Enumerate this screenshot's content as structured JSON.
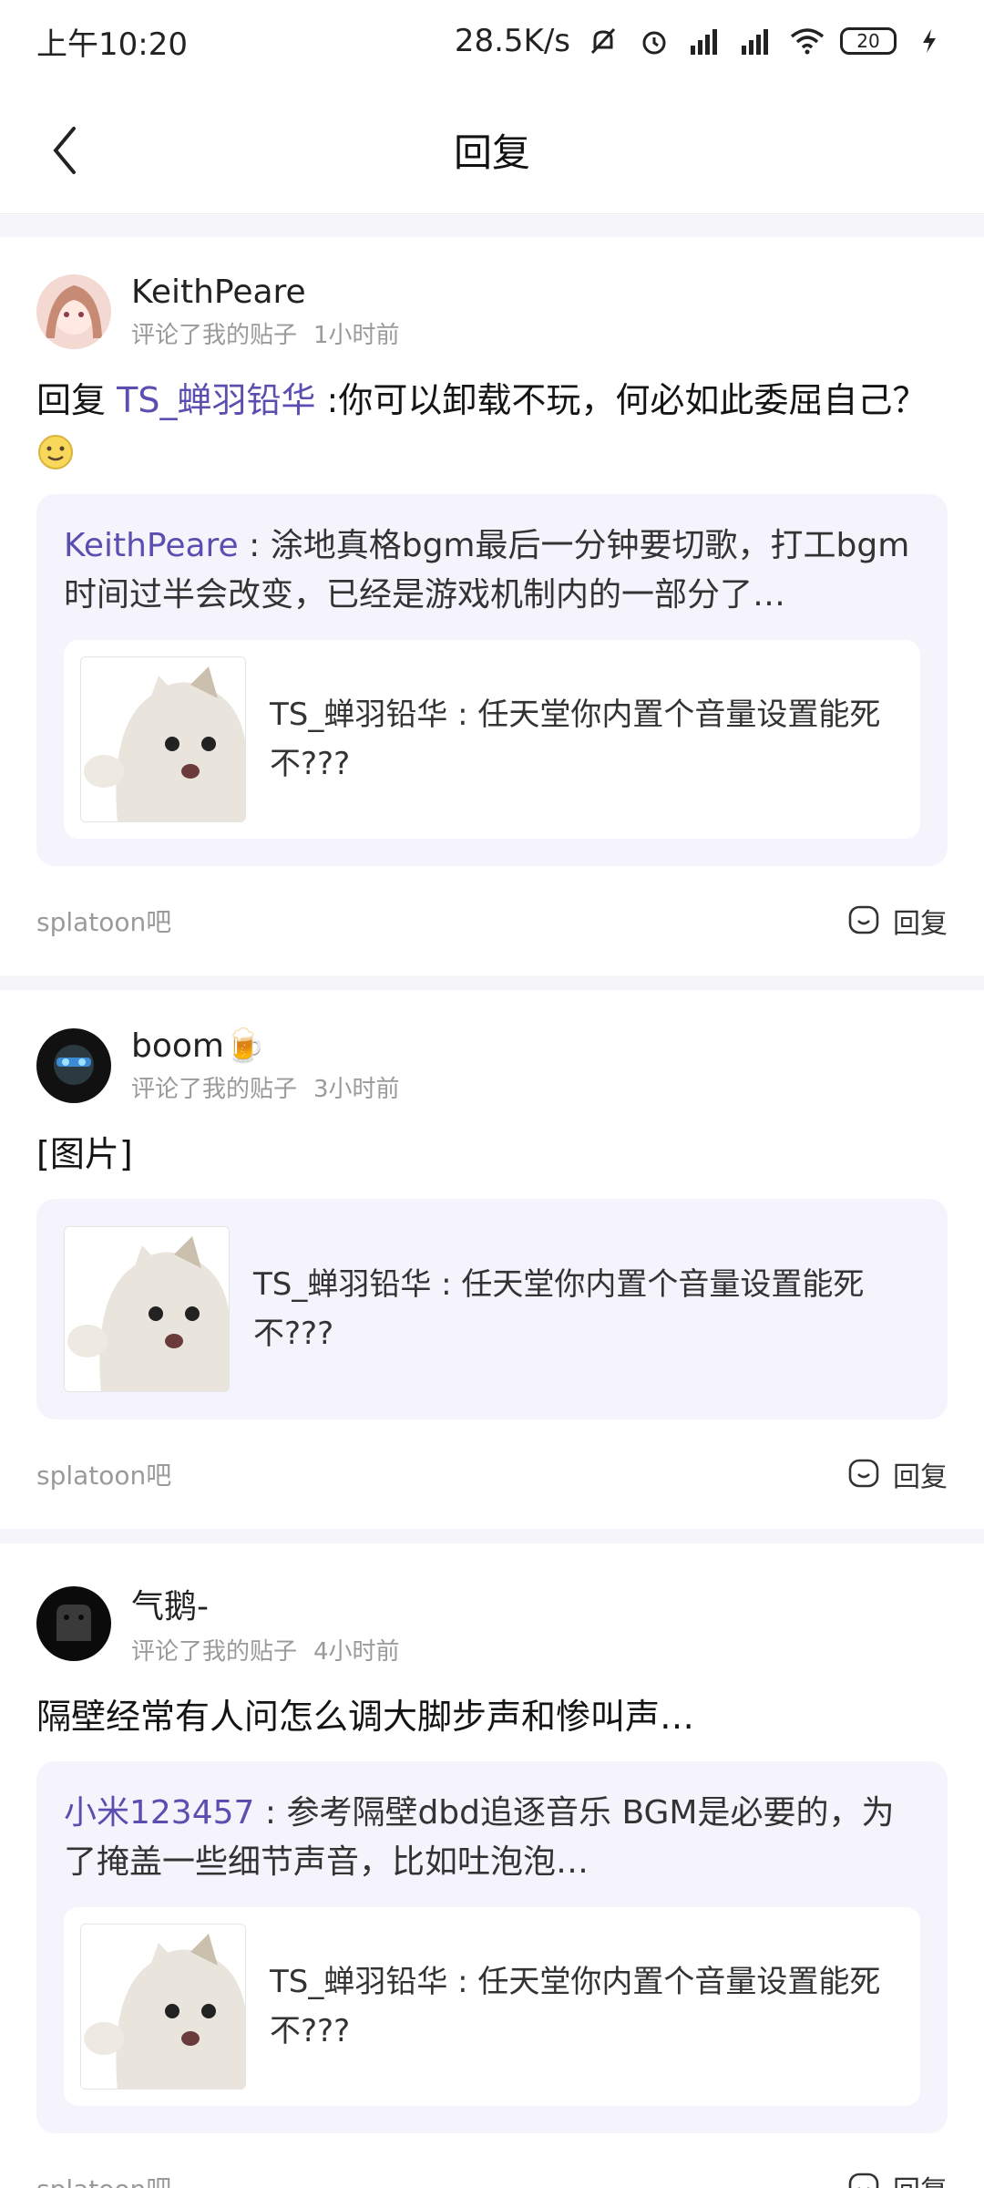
{
  "status": {
    "time": "上午10:20",
    "speed": "28.5K/s",
    "battery": "20"
  },
  "nav": {
    "title": "回复"
  },
  "cards": [
    {
      "username": "KeithPeare",
      "action": "评论了我的贴子",
      "time": "1小时前",
      "reply_prefix": "回复",
      "mention": "TS_蝉羽铅华",
      "content": " :你可以卸载不玩，何必如此委屈自己？",
      "quote_user": "KeithPeare",
      "quote_text": " : 涂地真格bgm最后一分钟要切歌，打工bgm时间过半会改变，已经是游戏机制内的一部分了…",
      "orig_text": "TS_蝉羽铅华 : 任天堂你内置个音量设置能死不???",
      "tieba": "splatoon吧",
      "reply_label": "回复"
    },
    {
      "username": "boom🍺",
      "action": "评论了我的贴子",
      "time": "3小时前",
      "content": "[图片]",
      "orig_text": "TS_蝉羽铅华 : 任天堂你内置个音量设置能死不???",
      "tieba": "splatoon吧",
      "reply_label": "回复"
    },
    {
      "username": "气鹅-",
      "action": "评论了我的贴子",
      "time": "4小时前",
      "content": "隔壁经常有人问怎么调大脚步声和惨叫声…",
      "quote_user": "小米123457",
      "quote_text": " : 参考隔壁dbd追逐音乐 BGM是必要的，为了掩盖一些细节声音，比如吐泡泡…",
      "orig_text": "TS_蝉羽铅华 : 任天堂你内置个音量设置能死不???",
      "tieba": "splatoon吧",
      "reply_label": "回复"
    }
  ]
}
